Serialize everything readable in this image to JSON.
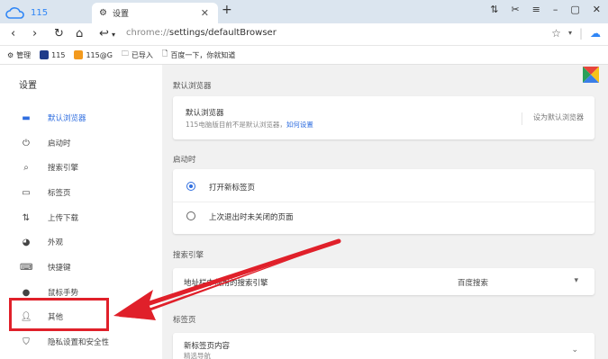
{
  "tabs": [
    {
      "label": "115"
    },
    {
      "label": "设置"
    }
  ],
  "toolbar": {
    "url_scheme": "chrome://",
    "url_path": "settings/defaultBrowser"
  },
  "bookmarks": [
    {
      "label": "管理",
      "icon": "gear-icon"
    },
    {
      "label": "115",
      "icon": "115-square-icon"
    },
    {
      "label": "115@G",
      "icon": "orange-square-icon"
    },
    {
      "label": "已导入",
      "icon": "folder-icon"
    },
    {
      "label": "百度一下，你就知道",
      "icon": "page-icon"
    }
  ],
  "sidebar": {
    "title": "设置",
    "items": [
      {
        "label": "默认浏览器",
        "icon": "browser-icon",
        "active": true
      },
      {
        "label": "启动时",
        "icon": "power-icon"
      },
      {
        "label": "搜索引擎",
        "icon": "search-icon"
      },
      {
        "label": "标签页",
        "icon": "tab-icon"
      },
      {
        "label": "上传下载",
        "icon": "updown-icon"
      },
      {
        "label": "外观",
        "icon": "palette-icon"
      },
      {
        "label": "快捷键",
        "icon": "keyboard-icon"
      },
      {
        "label": "鼠标手势",
        "icon": "mouse-icon"
      },
      {
        "label": "其他",
        "icon": "person-icon"
      },
      {
        "label": "隐私设置和安全性",
        "icon": "shield-icon"
      }
    ]
  },
  "main": {
    "default_browser": {
      "section": "默认浏览器",
      "label": "默认浏览器",
      "desc": "115电脑版目前不是默认浏览器，",
      "link": "如何设置",
      "button": "设为默认浏览器"
    },
    "startup": {
      "section": "启动时",
      "opt1": "打开新标签页",
      "opt2": "上次退出时未关闭的页面"
    },
    "search": {
      "section": "搜索引擎",
      "label": "地址栏中使用的搜索引擎",
      "value": "百度搜索"
    },
    "newtab": {
      "section": "标签页",
      "label": "新标签页内容",
      "sub": "精选导航"
    }
  },
  "colors": {
    "accent": "#2f6ee0",
    "annotation": "#e0202a",
    "brand": "#2f86f6"
  }
}
